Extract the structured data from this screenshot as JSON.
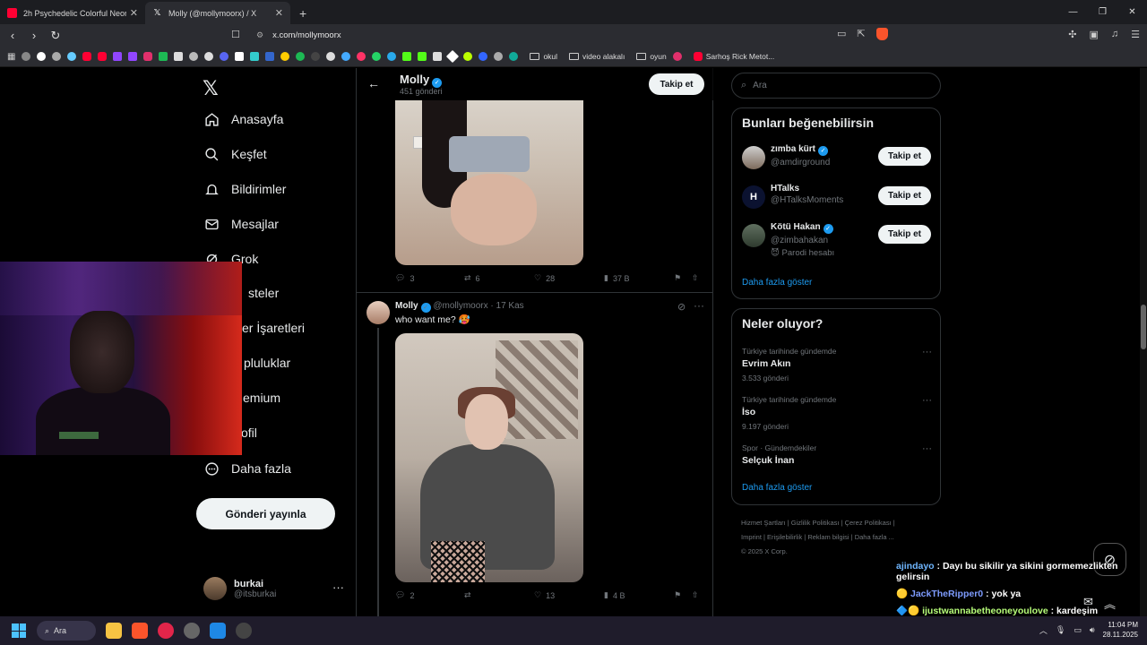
{
  "browser": {
    "tabs": [
      {
        "title": "2h Psychedelic Colorful Neon Ba",
        "favicon_color": "#ff0033",
        "active": false
      },
      {
        "title": "Molly (@mollymoorx) / X",
        "favicon_color": "#ffffff",
        "active": true
      }
    ],
    "new_tab": "+",
    "url": "x.com/mollymoorx",
    "bookmarks_folders": [
      "okul",
      "video alakalı",
      "oyun",
      "Sarhoş Rick Metot..."
    ]
  },
  "sidebar": {
    "logo": "𝕏",
    "items": [
      {
        "label": "Anasayfa",
        "icon": "home-icon"
      },
      {
        "label": "Keşfet",
        "icon": "search-icon"
      },
      {
        "label": "Bildirimler",
        "icon": "bell-icon"
      },
      {
        "label": "Mesajlar",
        "icon": "mail-icon"
      },
      {
        "label": "Grok",
        "icon": "grok-icon"
      },
      {
        "label": "steler",
        "icon": "list-icon"
      },
      {
        "label": "er İşaretleri",
        "icon": "bookmark-icon"
      },
      {
        "label": "pluluklar",
        "icon": "community-icon"
      },
      {
        "label": "emium",
        "icon": "premium-icon"
      },
      {
        "label": "ofil",
        "icon": "profile-icon"
      },
      {
        "label": "Daha fazla",
        "icon": "more-circle-icon"
      }
    ],
    "post_button": "Gönderi yayınla",
    "account": {
      "name": "burkai",
      "handle": "@itsburkai",
      "more": "···"
    }
  },
  "timeline": {
    "header": {
      "name": "Molly",
      "subtitle": "451 gönderi",
      "follow": "Takip et"
    },
    "tweet1": {
      "replies": "3",
      "retweets": "6",
      "likes": "28",
      "views": "37 B"
    },
    "tweet2": {
      "name": "Molly",
      "handle": "@mollymoorx",
      "dot": "·",
      "date": "17 Kas",
      "text": "who want me? 🥵",
      "replies": "2",
      "retweets": "",
      "likes": "13",
      "views": "4 B"
    }
  },
  "right": {
    "search_placeholder": "Ara",
    "suggest": {
      "title": "Bunları beğenebilirsin",
      "users": [
        {
          "name": "zımba kürt",
          "handle": "@amdirground",
          "verified": true,
          "note": "",
          "follow": "Takip et"
        },
        {
          "name": "HTalks",
          "handle": "@HTalksMoments",
          "verified": false,
          "note": "",
          "follow": "Takip et"
        },
        {
          "name": "Kötü Hakan",
          "handle": "@zimbahakan",
          "verified": true,
          "note": "😈 Parodi hesabı",
          "follow": "Takip et"
        }
      ],
      "show_more": "Daha fazla göster"
    },
    "trends": {
      "title": "Neler oluyor?",
      "items": [
        {
          "context": "Türkiye tarihinde gündemde",
          "topic": "Evrim Akın",
          "count": "3.533 gönderi"
        },
        {
          "context": "Türkiye tarihinde gündemde",
          "topic": "İso",
          "count": "9.197 gönderi"
        },
        {
          "context": "Spor · Gündemdekiler",
          "topic": "Selçuk İnan",
          "count": ""
        }
      ],
      "show_more": "Daha fazla göster"
    },
    "footer": {
      "line1": "Hizmet Şartları  |  Gizlilik Politikası  |  Çerez Politikası  |",
      "line2": "Imprint  |  Erişilebilirlik  |  Reklam bilgisi  |  Daha fazla ...",
      "line3": "© 2025 X Corp."
    }
  },
  "chat_overlay": [
    {
      "user": "ajindayo",
      "msg": ": Dayı bu sikilir ya sikini gormemezlikten gelirsin"
    },
    {
      "user": "JackTheRipper0",
      "msg": ": yok ya"
    },
    {
      "user": "ijustwannabetheoneyoulove",
      "msg": ": kardeşim translarla ilgilenmiyorum"
    }
  ],
  "taskbar": {
    "search": "Ara",
    "time": "11:04 PM",
    "date": "28.11.2025"
  },
  "colors": {
    "accent": "#1d9bf0",
    "bg": "#000000",
    "muted": "#71767b"
  }
}
